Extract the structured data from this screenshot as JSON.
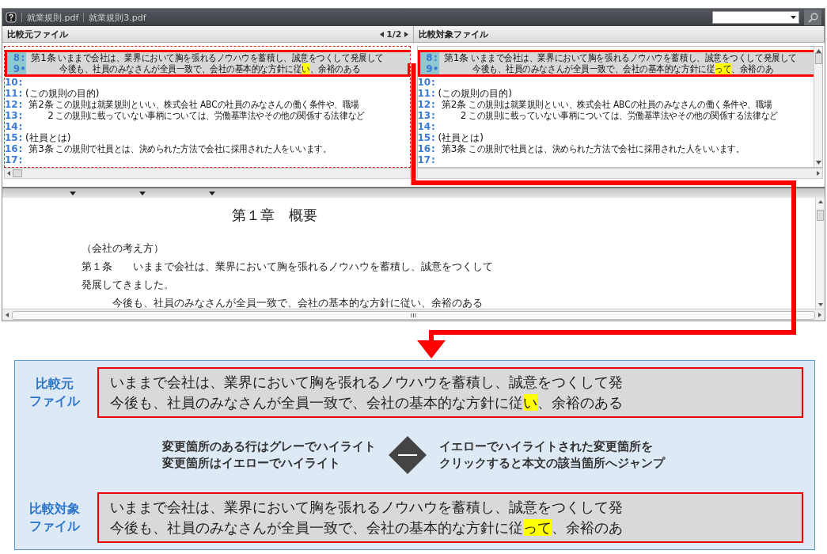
{
  "window": {
    "files": [
      "就業規則.pdf",
      "就業規則3.pdf"
    ]
  },
  "panes": [
    {
      "title": "比較元ファイル",
      "page": "1/2",
      "focused": true,
      "lines": [
        {
          "num": "8",
          "marker": ":",
          "changed": true,
          "kind": "article",
          "article": "第1条",
          "segments": [
            {
              "text": "いままで会社は、業界において胸を張れるノウハウを蓄積し、誠意をつくして発展して",
              "highlight": false
            }
          ]
        },
        {
          "num": "9",
          "marker": "•",
          "changed": true,
          "kind": "continuation",
          "segments": [
            {
              "text": "今後も、社員のみなさんが全員一致で、会社の基本的な方針に従",
              "highlight": false
            },
            {
              "text": "い",
              "highlight": true
            },
            {
              "text": "、余裕のある",
              "highlight": false
            }
          ]
        },
        {
          "num": "10",
          "marker": ":",
          "changed": false,
          "kind": "blank"
        },
        {
          "num": "11",
          "marker": ":",
          "changed": false,
          "kind": "heading",
          "segments": [
            {
              "text": "(この規則の目的)",
              "highlight": false
            }
          ]
        },
        {
          "num": "12",
          "marker": ":",
          "changed": false,
          "kind": "article",
          "article": "第2条",
          "segments": [
            {
              "text": "この規則は就業規則といい、株式会社 ABCの社員のみなさんの働く条件や、職場",
              "highlight": false
            }
          ]
        },
        {
          "num": "13",
          "marker": ":",
          "changed": false,
          "kind": "article",
          "article": "2",
          "segments": [
            {
              "text": "この規則に載っていない事柄については、労働基準法やその他の関係する法律など",
              "highlight": false
            }
          ]
        },
        {
          "num": "14",
          "marker": ":",
          "changed": false,
          "kind": "blank"
        },
        {
          "num": "15",
          "marker": ":",
          "changed": false,
          "kind": "heading",
          "segments": [
            {
              "text": "(社員とは)",
              "highlight": false
            }
          ]
        },
        {
          "num": "16",
          "marker": ":",
          "changed": false,
          "kind": "article",
          "article": "第3条",
          "segments": [
            {
              "text": "この規則で社員とは、決められた方法で会社に採用された人をいいます。",
              "highlight": false
            }
          ]
        },
        {
          "num": "17",
          "marker": ":",
          "changed": false,
          "kind": "blank"
        }
      ]
    },
    {
      "title": "比較対象ファイル",
      "focused": false,
      "lines": [
        {
          "num": "8",
          "marker": ":",
          "changed": true,
          "kind": "article",
          "article": "第1条",
          "segments": [
            {
              "text": "いままで会社は、業界において胸を張れるノウハウを蓄積し、誠意をつくして発展して",
              "highlight": false
            }
          ]
        },
        {
          "num": "9",
          "marker": "•",
          "changed": true,
          "kind": "continuation",
          "segments": [
            {
              "text": "今後も、社員のみなさんが全員一致で、会社の基本的な方針に従",
              "highlight": false
            },
            {
              "text": "って",
              "highlight": true
            },
            {
              "text": "、余裕のあ",
              "highlight": false
            }
          ]
        },
        {
          "num": "10",
          "marker": ":",
          "changed": false,
          "kind": "blank"
        },
        {
          "num": "11",
          "marker": ":",
          "changed": false,
          "kind": "heading",
          "segments": [
            {
              "text": "(この規則の目的)",
              "highlight": false
            }
          ]
        },
        {
          "num": "12",
          "marker": ":",
          "changed": false,
          "kind": "article",
          "article": "第2条",
          "segments": [
            {
              "text": "この規則は就業規則といい、株式会社 ABCの社員のみなさんの働く条件や、職場",
              "highlight": false
            }
          ]
        },
        {
          "num": "13",
          "marker": ":",
          "changed": false,
          "kind": "article",
          "article": "2",
          "segments": [
            {
              "text": "この規則に載っていない事柄については、労働基準法やその他の関係する法律など",
              "highlight": false
            }
          ]
        },
        {
          "num": "14",
          "marker": ":",
          "changed": false,
          "kind": "blank"
        },
        {
          "num": "15",
          "marker": ":",
          "changed": false,
          "kind": "heading",
          "segments": [
            {
              "text": "(社員とは)",
              "highlight": false
            }
          ]
        },
        {
          "num": "16",
          "marker": ":",
          "changed": false,
          "kind": "article",
          "article": "第3条",
          "segments": [
            {
              "text": "この規則で社員とは、決められた方法で会社に採用された人をいいます。",
              "highlight": false
            }
          ]
        },
        {
          "num": "17",
          "marker": ":",
          "changed": false,
          "kind": "blank"
        }
      ]
    }
  ],
  "document": {
    "heading": "第１章　概要",
    "lines": [
      "（会社の考え方）",
      "第１条　　いままで会社は、業界において胸を張れるノウハウを蓄積し、誠意をつくして",
      "発展してきました。",
      "　　　今後も、社員のみなさんが全員一致で、会社の基本的な方針に従い、余裕のある"
    ]
  },
  "callout": {
    "rows": [
      {
        "label": [
          "比較元",
          "ファイル"
        ],
        "lines": [
          [
            {
              "text": "いままで会社は、業界において胸を張れるノウハウを蓄積し、誠意をつくして発",
              "highlight": false
            }
          ],
          [
            {
              "text": "今後も、社員のみなさんが全員一致で、会社の基本的な方針に従",
              "highlight": false
            },
            {
              "text": "い",
              "highlight": true
            },
            {
              "text": "、余裕のある",
              "highlight": false
            }
          ]
        ]
      },
      {
        "label": [
          "比較対象",
          "ファイル"
        ],
        "lines": [
          [
            {
              "text": "いままで会社は、業界において胸を張れるノウハウを蓄積し、誠意をつくして発",
              "highlight": false
            }
          ],
          [
            {
              "text": "今後も、社員のみなさんが全員一致で、会社の基本的な方針に従",
              "highlight": false
            },
            {
              "text": "って",
              "highlight": true
            },
            {
              "text": "、余裕のあ",
              "highlight": false
            }
          ]
        ]
      }
    ],
    "notes": [
      [
        "変更箇所のある行はグレーでハイライト",
        "変更箇所はイエローでハイライト"
      ],
      [
        "イエローでハイライトされた変更箇所を",
        "クリックすると本文の該当箇所へジャンプ"
      ]
    ]
  }
}
